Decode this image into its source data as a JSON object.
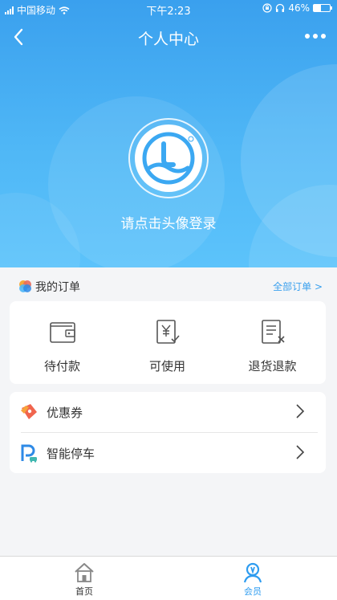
{
  "status_bar": {
    "carrier": "中国移动",
    "time": "下午2:23",
    "battery_percent": "46%",
    "battery_level": 0.46
  },
  "nav": {
    "title": "个人中心",
    "back_icon": "chevron-left-icon",
    "more_icon": "more-dots-icon"
  },
  "profile": {
    "login_prompt": "请点击头像登录",
    "avatar_icon": "wanda-logo-icon"
  },
  "orders": {
    "title": "我的订单",
    "all_link": "全部订单 >",
    "items": [
      {
        "label": "待付款",
        "icon": "wallet-icon"
      },
      {
        "label": "可使用",
        "icon": "yen-ticket-icon"
      },
      {
        "label": "退货退款",
        "icon": "refund-document-icon"
      }
    ]
  },
  "services": [
    {
      "label": "优惠券",
      "icon": "coupon-icon"
    },
    {
      "label": "智能停车",
      "icon": "parking-icon"
    }
  ],
  "tabbar": {
    "items": [
      {
        "label": "首页",
        "icon": "home-icon",
        "active": false
      },
      {
        "label": "会员",
        "icon": "member-icon",
        "active": true
      }
    ]
  },
  "colors": {
    "header_blue": "#3aa0ee",
    "accent_blue": "#2e9cf0",
    "page_bg": "#f4f5f7"
  }
}
